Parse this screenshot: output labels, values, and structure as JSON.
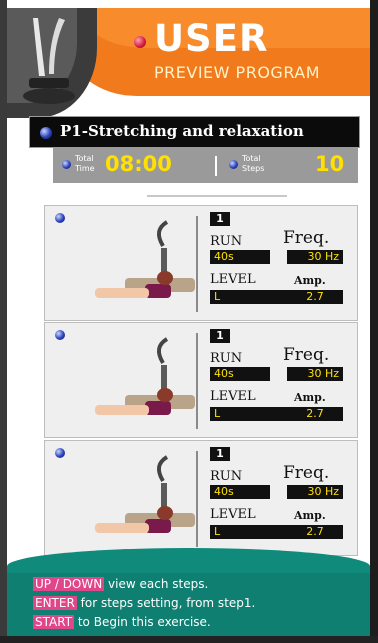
{
  "header": {
    "title": "USER",
    "subtitle": "PREVIEW PROGRAM",
    "icon": "vibration-machine-icon"
  },
  "program": {
    "title": "P1-Stretching and relaxation",
    "total_time_label_1": "Total",
    "total_time_label_2": "Time",
    "total_time_value": "08:00",
    "total_steps_label_1": "Total",
    "total_steps_label_2": "Steps",
    "total_steps_value": "10"
  },
  "steps": [
    {
      "step": "1",
      "run_label": "RUN",
      "run": "40s",
      "freq_label": "Freq.",
      "freq": "30 Hz",
      "level_label": "LEVEL",
      "level": "L",
      "amp_label": "Amp.",
      "amp": "2.7"
    },
    {
      "step": "1",
      "run_label": "RUN",
      "run": "40s",
      "freq_label": "Freq.",
      "freq": "30 Hz",
      "level_label": "LEVEL",
      "level": "L",
      "amp_label": "Amp.",
      "amp": "2.7"
    },
    {
      "step": "1",
      "run_label": "RUN",
      "run": "40s",
      "freq_label": "Freq.",
      "freq": "30 Hz",
      "level_label": "LEVEL",
      "level": "L",
      "amp_label": "Amp.",
      "amp": "2.7"
    }
  ],
  "footer": {
    "line1_key": "UP / DOWN",
    "line1_text": " view each steps.",
    "line2_key": "ENTER",
    "line2_text": " for steps setting, from step1.",
    "line3_key": "START",
    "line3_text": " to Begin this exercise."
  },
  "colors": {
    "accent_orange": "#f07a1c",
    "value_yellow": "#ffe000",
    "footer_teal": "#0f7f72",
    "key_pink": "#e0468a"
  }
}
